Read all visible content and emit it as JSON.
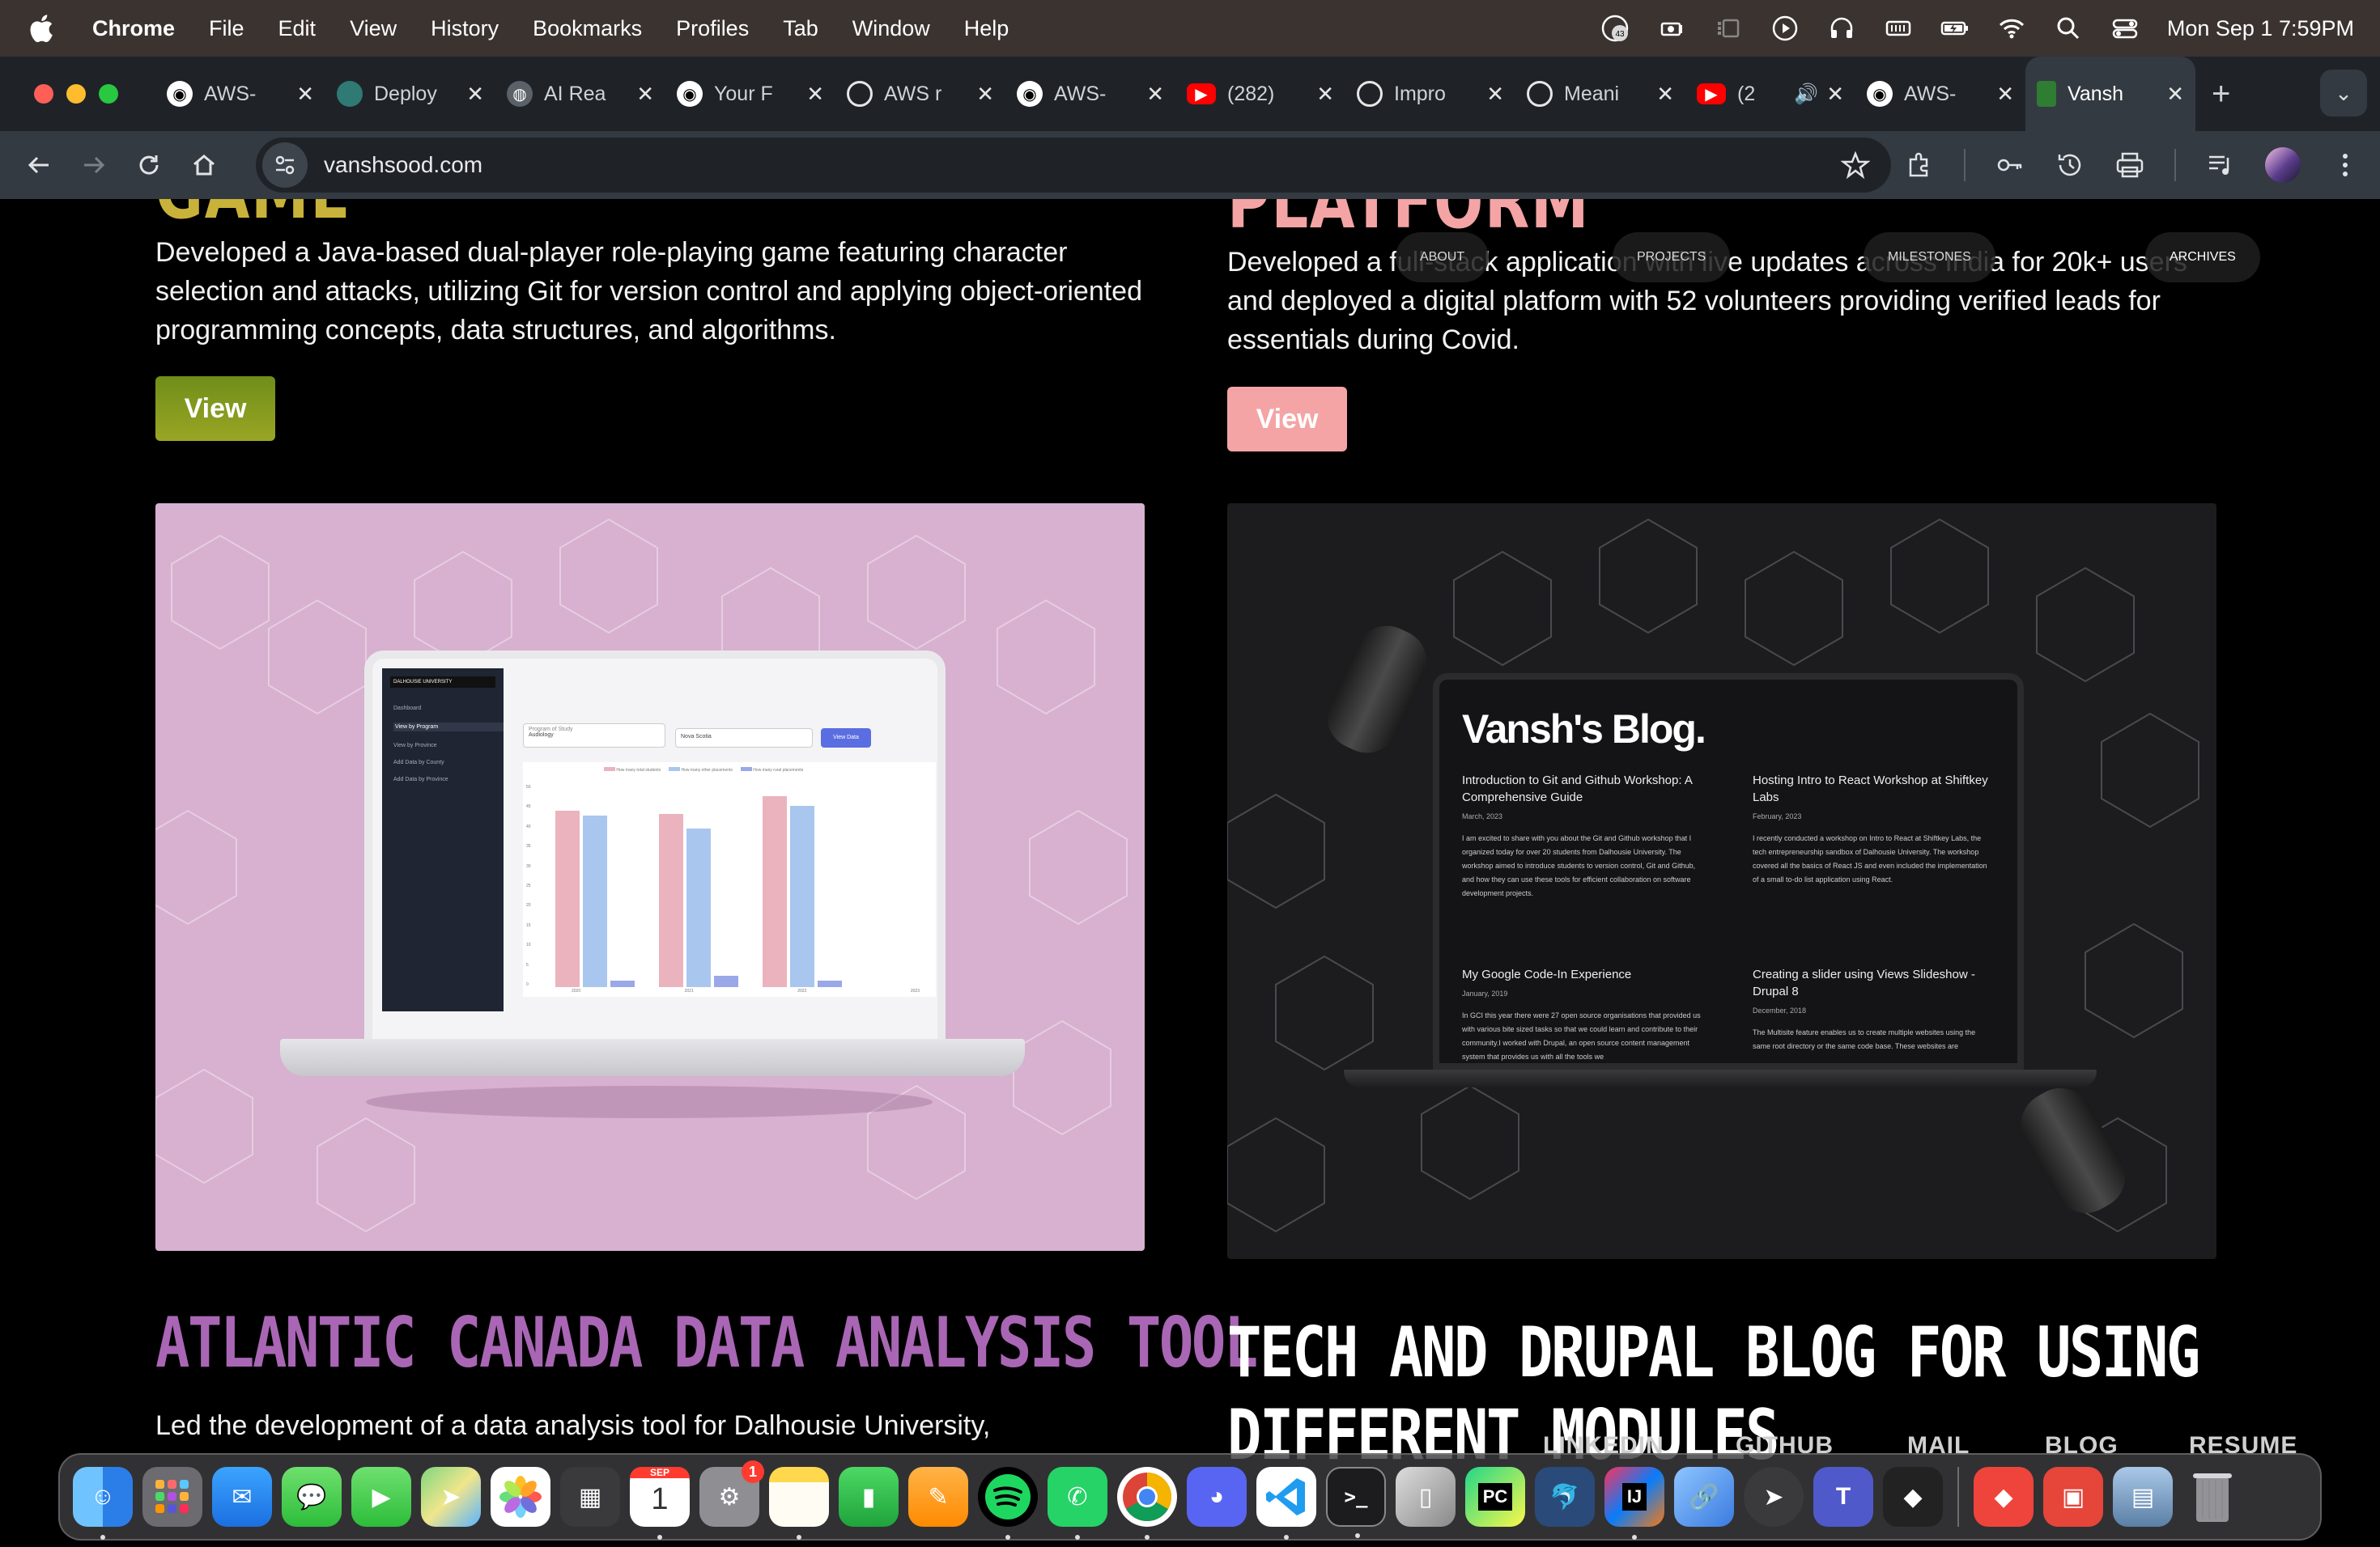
{
  "menubar": {
    "items": [
      "Chrome",
      "File",
      "Edit",
      "View",
      "History",
      "Bookmarks",
      "Profiles",
      "Tab",
      "Window",
      "Help"
    ],
    "clock": "Mon Sep 1  7:59PM",
    "status_badge": "43"
  },
  "tabs": [
    {
      "title": "AWS-",
      "icon": "github-icon"
    },
    {
      "title": "Deploy",
      "icon": "deploy-icon"
    },
    {
      "title": "AI Rea",
      "icon": "globe-icon"
    },
    {
      "title": "Your F",
      "icon": "github-icon"
    },
    {
      "title": "AWS r",
      "icon": "openai-icon"
    },
    {
      "title": "AWS-",
      "icon": "github-icon"
    },
    {
      "title": "(282)",
      "icon": "youtube-icon"
    },
    {
      "title": "Impro",
      "icon": "openai-icon"
    },
    {
      "title": "Meani",
      "icon": "openai-icon"
    },
    {
      "title": "(2",
      "icon": "youtube-icon"
    },
    {
      "title": "AWS-",
      "icon": "github-icon"
    },
    {
      "title": "Vansh",
      "icon": "doc-icon",
      "active": true
    }
  ],
  "address": {
    "url": "vanshsood.com"
  },
  "site": {
    "nav": [
      "ABOUT",
      "PROJECTS",
      "MILESTONES",
      "ARCHIVES"
    ],
    "footer_nav": [
      "LINKEDIN",
      "GITHUB",
      "MAIL",
      "BLOG",
      "RESUME"
    ],
    "project_left_top": {
      "title_fragment": "GAME",
      "description": "Developed a Java-based dual-player role-playing game featuring character selection and attacks, utilizing Git for version control and applying object-oriented programming concepts, data structures, and algorithms.",
      "button": "View"
    },
    "project_right_top": {
      "title_fragment": "PLATFORM",
      "description": "Developed a full-stack application with live updates across India for 20k+ users and deployed a digital platform with 52 volunteers providing verified leads for essentials during Covid.",
      "button": "View"
    },
    "project_left": {
      "title": "ATLANTIC CANADA DATA ANALYSIS TOOL",
      "description": "Led the development of a data analysis tool for Dalhousie University,",
      "mock": {
        "university": "DALHOUSIE UNIVERSITY",
        "sidebar": [
          "Dashboard",
          "View by Program",
          "View by Province",
          "Add Data by County",
          "Add Data by Province"
        ],
        "select_program_label": "Program of Study",
        "select_program_value": "Audiology",
        "select_province_value": "Nova Scotia",
        "button": "View Data",
        "legend": [
          "How many total students",
          "How many other placements",
          "How many rural placements"
        ],
        "years": [
          "2020",
          "2021",
          "2022",
          "2023"
        ],
        "yticks": [
          "50",
          "45",
          "40",
          "35",
          "30",
          "25",
          "20",
          "15",
          "10",
          "5",
          "0"
        ]
      }
    },
    "project_right": {
      "title_line1": "TECH AND DRUPAL BLOG FOR USING",
      "title_line2": "DIFFERENT MODULES",
      "mock": {
        "heading": "Vansh's Blog.",
        "posts": [
          {
            "title": "Introduction to Git and Github Workshop: A Comprehensive Guide",
            "date": "March, 2023",
            "body": "I am excited to share with you about the Git and Github workshop that I organized today for over 20 students from Dalhousie University. The workshop aimed to introduce students to version control, Git and Github, and how they can use these tools for efficient collaboration on software development projects."
          },
          {
            "title": "Hosting Intro to React Workshop at Shiftkey Labs",
            "date": "February, 2023",
            "body": "I recently conducted a workshop on Intro to React at Shiftkey Labs, the tech entrepreneurship sandbox of Dalhousie University. The workshop covered all the basics of React JS and even included the implementation of a small to-do list application using React."
          },
          {
            "title": "My Google Code-In Experience",
            "date": "January, 2019",
            "body": "In GCI this year there were 27 open source organisations that provided us with various bite sized tasks so that we could learn and contribute to their community.I worked with Drupal, an open source content management system that provides us with all the tools we"
          },
          {
            "title": "Creating a slider using Views Slideshow - Drupal 8",
            "date": "December, 2018",
            "body": "The Multisite feature enables us to create multiple websites using the same root directory or the same code base. These websites are"
          }
        ]
      }
    }
  },
  "colors": {
    "left_card_bg": "#d7b1cf",
    "right_card_bg": "#1c1c1e",
    "left_title": "#a966b4",
    "left_button": "#7f9a1d",
    "right_button": "#f4a4a4"
  },
  "dock": {
    "calendar_month": "SEP",
    "calendar_day": "1",
    "settings_badge": "1",
    "apps": [
      "Finder",
      "Launchpad",
      "Mail",
      "Messages",
      "FaceTime",
      "Maps",
      "Photos",
      "Calculator",
      "Calendar",
      "System Settings",
      "Notes",
      "Numbers",
      "Pages",
      "Spotify",
      "WhatsApp",
      "Chrome",
      "Discord",
      "VS Code",
      "Terminal",
      "iPhone Mirroring",
      "PyCharm",
      "MySQL Workbench",
      "IntelliJ IDEA",
      "Link",
      "Telegram",
      "Teams",
      "Unity",
      "AnyDesk",
      "Preview",
      "Image Capture",
      "Trash"
    ]
  }
}
